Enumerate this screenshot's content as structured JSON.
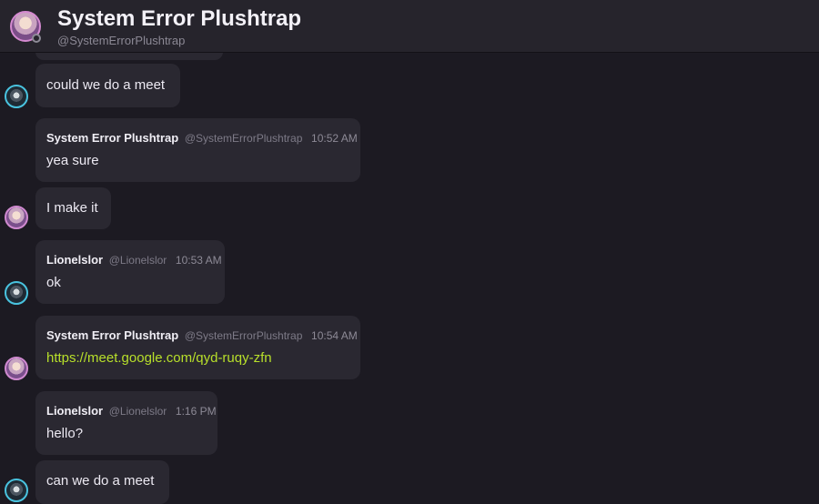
{
  "header": {
    "title": "System Error Plushtrap",
    "handle": "@SystemErrorPlushtrap"
  },
  "messages": [
    {
      "text": "could we do a meet"
    },
    {
      "name": "System Error Plushtrap",
      "handle": "@SystemErrorPlushtrap",
      "time": "10:52 AM",
      "text": "yea sure"
    },
    {
      "text": "I make it"
    },
    {
      "name": "Lionelslor",
      "handle": "@Lionelslor",
      "time": "10:53 AM",
      "text": "ok"
    },
    {
      "name": "System Error Plushtrap",
      "handle": "@SystemErrorPlushtrap",
      "time": "10:54 AM",
      "text": "https://meet.google.com/qyd-ruqy-zfn"
    },
    {
      "name": "Lionelslor",
      "handle": "@Lionelslor",
      "time": "1:16 PM",
      "text": "hello?"
    },
    {
      "text": "can we do a meet"
    }
  ],
  "colors": {
    "background": "#1c1a22",
    "bubble": "#2a2831",
    "header": "#26242c",
    "link": "#b8e02a",
    "robot_ring": "#49c3df",
    "plush_ring": "#d08ad0"
  }
}
